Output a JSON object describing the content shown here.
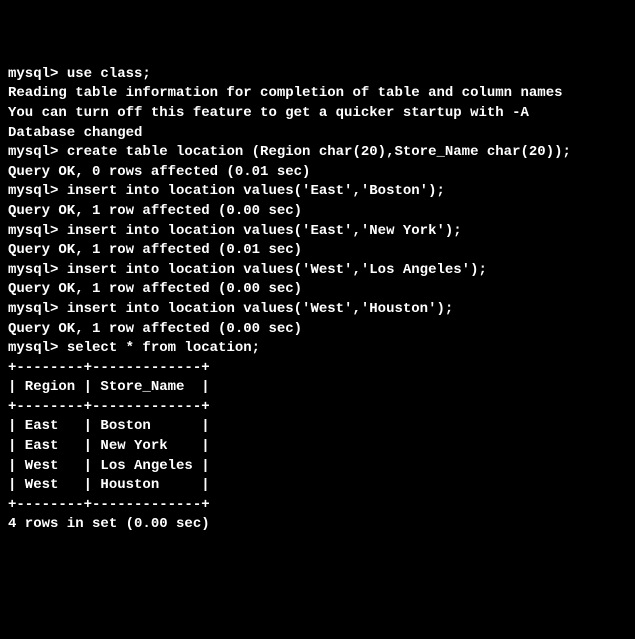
{
  "prompt": "mysql> ",
  "cmd1": "use class;",
  "cmd1_msg1": "Reading table information for completion of table and column names",
  "cmd1_msg2": "You can turn off this feature to get a quicker startup with -A",
  "cmd1_msg3": "Database changed",
  "cmd2": "create table location (Region char(20),Store_Name char(20));",
  "cmd2_msg": "Query OK, 0 rows affected (0.01 sec)",
  "insert1": "insert into location values('East','Boston');",
  "insert1_msg": "Query OK, 1 row affected (0.00 sec)",
  "insert2": "insert into location values('East','New York');",
  "insert2_msg": "Query OK, 1 row affected (0.01 sec)",
  "insert3": "insert into location values('West','Los Angeles');",
  "insert3_msg": "Query OK, 1 row affected (0.00 sec)",
  "insert4": "insert into location values('West','Houston');",
  "insert4_msg": "Query OK, 1 row affected (0.00 sec)",
  "select_cmd": "select * from location;",
  "table_sep": "+--------+-------------+",
  "table_header": "| Region | Store_Name  |",
  "table_row1": "| East   | Boston      |",
  "table_row2": "| East   | New York    |",
  "table_row3": "| West   | Los Angeles |",
  "table_row4": "| West   | Houston     |",
  "select_msg": "4 rows in set (0.00 sec)",
  "blank": ""
}
